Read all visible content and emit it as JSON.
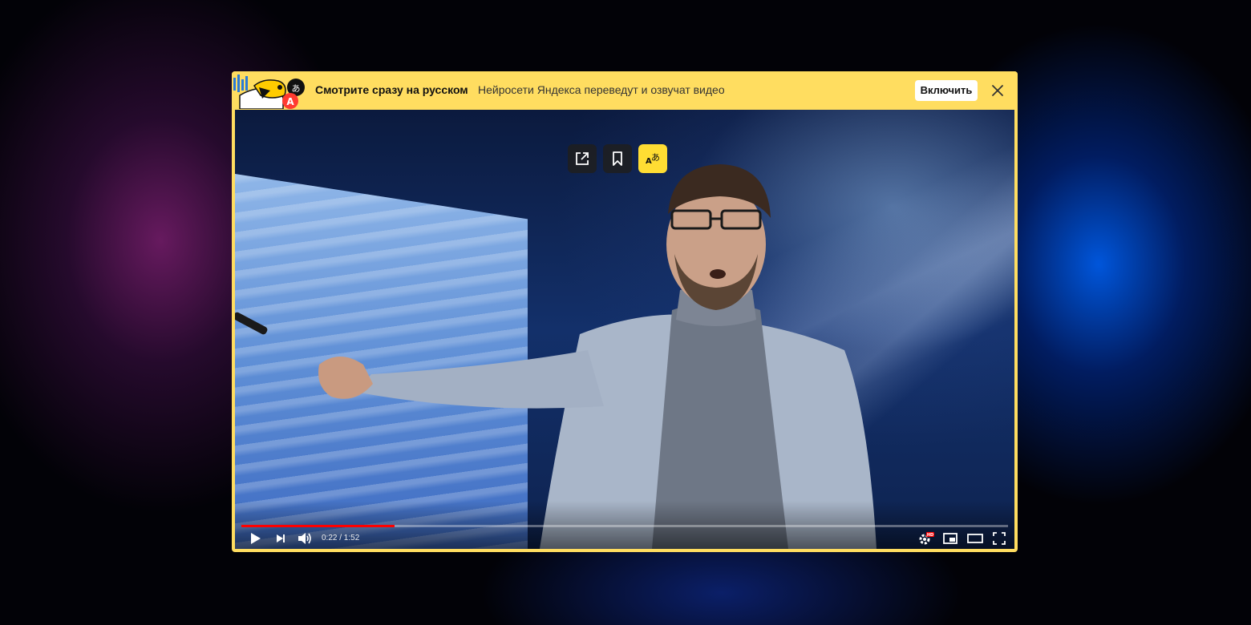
{
  "banner": {
    "title": "Смотрите сразу на русском",
    "subtitle": "Нейросети Яндекса переведут и озвучат видео",
    "enable_label": "Включить",
    "logo_icon": "yandex-translate-mascot-icon",
    "close_icon": "close-icon"
  },
  "video_overlay": {
    "buttons": [
      {
        "icon": "share-icon"
      },
      {
        "icon": "bookmark-icon"
      },
      {
        "icon": "translate-icon"
      }
    ]
  },
  "player": {
    "time_label": "0:22 / 1:52",
    "progress_fraction": 0.2,
    "progress_color": "#ff0000",
    "controls": [
      "play-icon",
      "next-icon",
      "volume-icon",
      "settings-icon",
      "miniplayer-icon",
      "theater-mode-icon",
      "fullscreen-icon"
    ],
    "settings_badge": "HD"
  },
  "colors": {
    "accent": "#ffdd60",
    "button_yellow": "#ffdd33"
  }
}
